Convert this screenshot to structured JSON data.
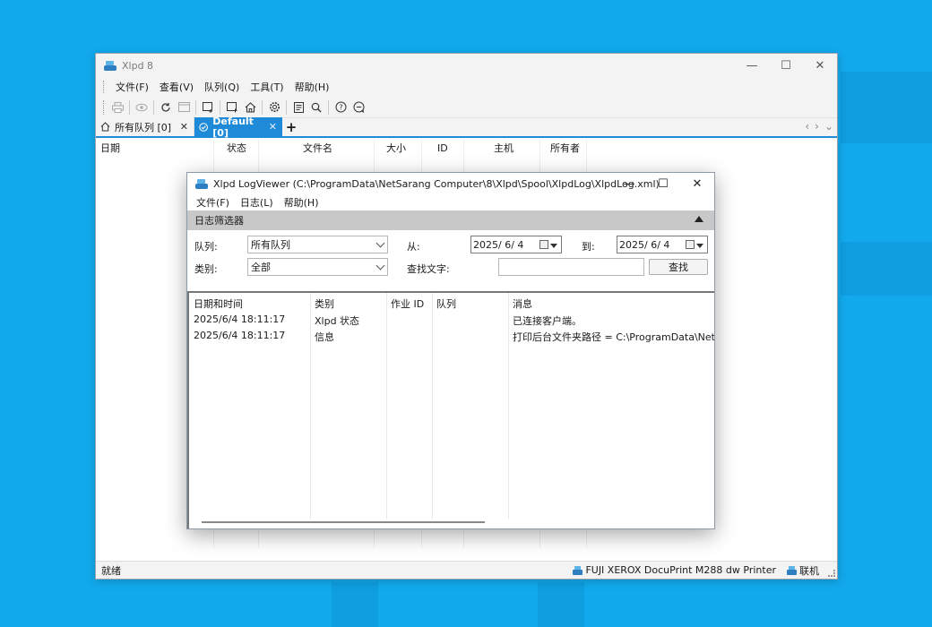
{
  "main": {
    "title": "Xlpd 8",
    "window_buttons": {
      "min": "—",
      "max": "☐",
      "close": "✕"
    },
    "menu": [
      "文件(F)",
      "查看(V)",
      "队列(Q)",
      "工具(T)",
      "帮助(H)"
    ],
    "tabs": [
      {
        "label": "所有队列 [0]",
        "close": "✕"
      },
      {
        "label": "Default [0]",
        "close": "✕"
      }
    ],
    "tab_add": "+",
    "tab_nav": {
      "prev": "‹",
      "next": "›",
      "menu": "⌄"
    },
    "columns": [
      "日期",
      "状态",
      "文件名",
      "大小",
      "ID",
      "主机",
      "所有者"
    ],
    "status": {
      "ready": "就绪",
      "printer": "FUJI XEROX DocuPrint M288 dw Printer",
      "online": "联机"
    }
  },
  "dialog": {
    "title": "Xlpd LogViewer (C:\\ProgramData\\NetSarang Computer\\8\\Xlpd\\Spool\\XlpdLog\\XlpdLog.xml)",
    "window_buttons": {
      "min": "—",
      "max": "☐",
      "close": "✕"
    },
    "menu": [
      "文件(F)",
      "日志(L)",
      "帮助(H)"
    ],
    "filter": {
      "header": "日志筛选器",
      "queue_label": "队列:",
      "queue_value": "所有队列",
      "type_label": "类别:",
      "type_value": "全部",
      "from_label": "从:",
      "from_value": "2025/  6/  4",
      "to_label": "到:",
      "to_value": "2025/  6/  4",
      "find_label": "查找文字:",
      "find_value": "",
      "find_button": "查找"
    },
    "grid": {
      "headers": [
        "日期和时间",
        "类别",
        "作业 ID",
        "队列",
        "消息"
      ],
      "rows": [
        [
          "2025/6/4 18:11:17",
          "Xlpd 状态",
          "",
          "",
          "已连接客户端。"
        ],
        [
          "2025/6/4 18:11:17",
          "信息",
          "",
          "",
          "打印后台文件夹路径 = C:\\ProgramData\\NetSar"
        ]
      ]
    }
  }
}
